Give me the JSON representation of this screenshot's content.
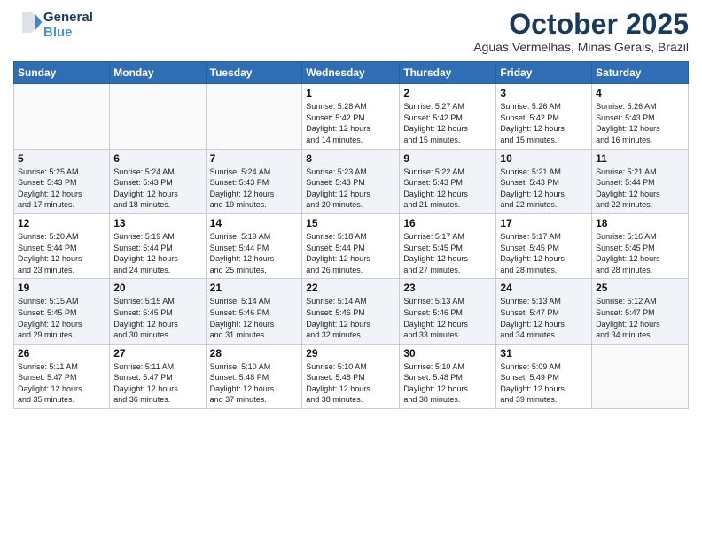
{
  "header": {
    "logo_line1": "General",
    "logo_line2": "Blue",
    "month_title": "October 2025",
    "location": "Aguas Vermelhas, Minas Gerais, Brazil"
  },
  "weekdays": [
    "Sunday",
    "Monday",
    "Tuesday",
    "Wednesday",
    "Thursday",
    "Friday",
    "Saturday"
  ],
  "weeks": [
    [
      {
        "day": "",
        "info": ""
      },
      {
        "day": "",
        "info": ""
      },
      {
        "day": "",
        "info": ""
      },
      {
        "day": "1",
        "info": "Sunrise: 5:28 AM\nSunset: 5:42 PM\nDaylight: 12 hours\nand 14 minutes."
      },
      {
        "day": "2",
        "info": "Sunrise: 5:27 AM\nSunset: 5:42 PM\nDaylight: 12 hours\nand 15 minutes."
      },
      {
        "day": "3",
        "info": "Sunrise: 5:26 AM\nSunset: 5:42 PM\nDaylight: 12 hours\nand 15 minutes."
      },
      {
        "day": "4",
        "info": "Sunrise: 5:26 AM\nSunset: 5:43 PM\nDaylight: 12 hours\nand 16 minutes."
      }
    ],
    [
      {
        "day": "5",
        "info": "Sunrise: 5:25 AM\nSunset: 5:43 PM\nDaylight: 12 hours\nand 17 minutes."
      },
      {
        "day": "6",
        "info": "Sunrise: 5:24 AM\nSunset: 5:43 PM\nDaylight: 12 hours\nand 18 minutes."
      },
      {
        "day": "7",
        "info": "Sunrise: 5:24 AM\nSunset: 5:43 PM\nDaylight: 12 hours\nand 19 minutes."
      },
      {
        "day": "8",
        "info": "Sunrise: 5:23 AM\nSunset: 5:43 PM\nDaylight: 12 hours\nand 20 minutes."
      },
      {
        "day": "9",
        "info": "Sunrise: 5:22 AM\nSunset: 5:43 PM\nDaylight: 12 hours\nand 21 minutes."
      },
      {
        "day": "10",
        "info": "Sunrise: 5:21 AM\nSunset: 5:43 PM\nDaylight: 12 hours\nand 22 minutes."
      },
      {
        "day": "11",
        "info": "Sunrise: 5:21 AM\nSunset: 5:44 PM\nDaylight: 12 hours\nand 22 minutes."
      }
    ],
    [
      {
        "day": "12",
        "info": "Sunrise: 5:20 AM\nSunset: 5:44 PM\nDaylight: 12 hours\nand 23 minutes."
      },
      {
        "day": "13",
        "info": "Sunrise: 5:19 AM\nSunset: 5:44 PM\nDaylight: 12 hours\nand 24 minutes."
      },
      {
        "day": "14",
        "info": "Sunrise: 5:19 AM\nSunset: 5:44 PM\nDaylight: 12 hours\nand 25 minutes."
      },
      {
        "day": "15",
        "info": "Sunrise: 5:18 AM\nSunset: 5:44 PM\nDaylight: 12 hours\nand 26 minutes."
      },
      {
        "day": "16",
        "info": "Sunrise: 5:17 AM\nSunset: 5:45 PM\nDaylight: 12 hours\nand 27 minutes."
      },
      {
        "day": "17",
        "info": "Sunrise: 5:17 AM\nSunset: 5:45 PM\nDaylight: 12 hours\nand 28 minutes."
      },
      {
        "day": "18",
        "info": "Sunrise: 5:16 AM\nSunset: 5:45 PM\nDaylight: 12 hours\nand 28 minutes."
      }
    ],
    [
      {
        "day": "19",
        "info": "Sunrise: 5:15 AM\nSunset: 5:45 PM\nDaylight: 12 hours\nand 29 minutes."
      },
      {
        "day": "20",
        "info": "Sunrise: 5:15 AM\nSunset: 5:45 PM\nDaylight: 12 hours\nand 30 minutes."
      },
      {
        "day": "21",
        "info": "Sunrise: 5:14 AM\nSunset: 5:46 PM\nDaylight: 12 hours\nand 31 minutes."
      },
      {
        "day": "22",
        "info": "Sunrise: 5:14 AM\nSunset: 5:46 PM\nDaylight: 12 hours\nand 32 minutes."
      },
      {
        "day": "23",
        "info": "Sunrise: 5:13 AM\nSunset: 5:46 PM\nDaylight: 12 hours\nand 33 minutes."
      },
      {
        "day": "24",
        "info": "Sunrise: 5:13 AM\nSunset: 5:47 PM\nDaylight: 12 hours\nand 34 minutes."
      },
      {
        "day": "25",
        "info": "Sunrise: 5:12 AM\nSunset: 5:47 PM\nDaylight: 12 hours\nand 34 minutes."
      }
    ],
    [
      {
        "day": "26",
        "info": "Sunrise: 5:11 AM\nSunset: 5:47 PM\nDaylight: 12 hours\nand 35 minutes."
      },
      {
        "day": "27",
        "info": "Sunrise: 5:11 AM\nSunset: 5:47 PM\nDaylight: 12 hours\nand 36 minutes."
      },
      {
        "day": "28",
        "info": "Sunrise: 5:10 AM\nSunset: 5:48 PM\nDaylight: 12 hours\nand 37 minutes."
      },
      {
        "day": "29",
        "info": "Sunrise: 5:10 AM\nSunset: 5:48 PM\nDaylight: 12 hours\nand 38 minutes."
      },
      {
        "day": "30",
        "info": "Sunrise: 5:10 AM\nSunset: 5:48 PM\nDaylight: 12 hours\nand 38 minutes."
      },
      {
        "day": "31",
        "info": "Sunrise: 5:09 AM\nSunset: 5:49 PM\nDaylight: 12 hours\nand 39 minutes."
      },
      {
        "day": "",
        "info": ""
      }
    ]
  ]
}
